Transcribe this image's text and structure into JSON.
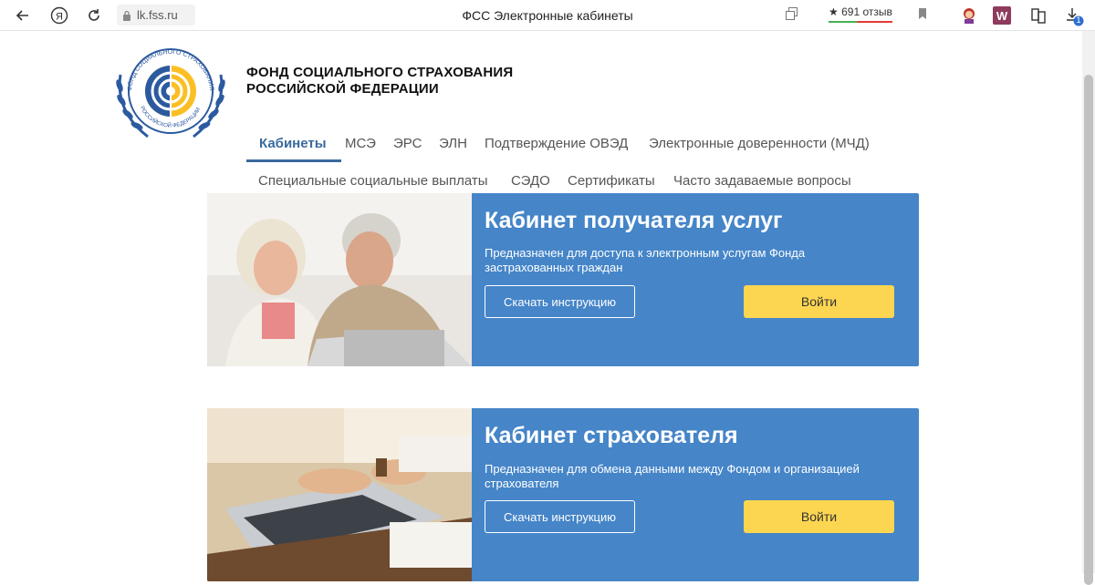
{
  "browser": {
    "url": "lk.fss.ru",
    "tab_title": "ФСС Электронные кабинеты",
    "reviews": "691 отзыв",
    "downloads_badge": "1"
  },
  "header": {
    "org_line1": "ФОНД СОЦИАЛЬНОГО СТРАХОВАНИЯ",
    "org_line2": "РОССИЙСКОЙ ФЕДЕРАЦИИ",
    "logo_ring_text": "ФОНД СОЦИАЛЬНОГО СТРАХОВАНИЯ",
    "logo_bottom_text": "РОССИЙСКОЙ ФЕДЕРАЦИИ"
  },
  "nav": {
    "row1": [
      "Кабинеты",
      "МСЭ",
      "ЭРС",
      "ЭЛН",
      "Подтверждение ОВЭД",
      "Электронные доверенности (МЧД)"
    ],
    "row2": [
      "Специальные социальные выплаты",
      "СЭДО",
      "Сертификаты",
      "Часто задаваемые вопросы"
    ]
  },
  "cards": [
    {
      "title": "Кабинет получателя услуг",
      "description": "Предназначен для доступа к электронным услугам Фонда застрахованных граждан",
      "instruction_label": "Скачать инструкцию",
      "login_label": "Войти"
    },
    {
      "title": "Кабинет страхователя",
      "description": "Предназначен для обмена данными между Фондом и организацией страхователя",
      "instruction_label": "Скачать инструкцию",
      "login_label": "Войти"
    }
  ],
  "colors": {
    "card_bg": "#4585c8",
    "login_button": "#fdd651",
    "nav_active": "#3a6a9e"
  }
}
